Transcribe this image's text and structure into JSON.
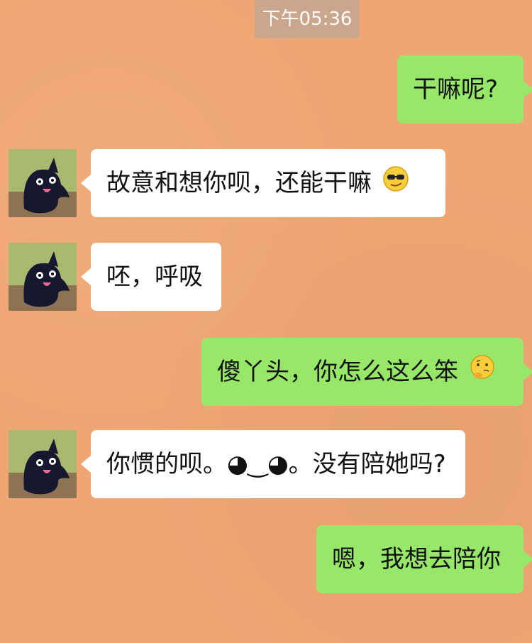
{
  "status": {
    "time": "下午05:36"
  },
  "messages": [
    {
      "side": "out",
      "text": "干嘛呢?"
    },
    {
      "side": "in",
      "text": "故意和想你呗，还能干嘛",
      "emoji": "sunglasses-emoji"
    },
    {
      "side": "in",
      "text": "呸，呼吸"
    },
    {
      "side": "out",
      "text": "傻丫头，你怎么这么笨",
      "emoji": "thinking-emoji"
    },
    {
      "side": "in",
      "text": "你惯的呗。◕‿◕。没有陪她吗?"
    },
    {
      "side": "out",
      "text": "嗯，我想去陪你"
    }
  ],
  "colors": {
    "background": "#efa673",
    "time_chip": "#c9a68c",
    "incoming_bubble": "#ffffff",
    "outgoing_bubble": "#97e868"
  },
  "avatar_icon": "black-ghost-avatar-icon"
}
